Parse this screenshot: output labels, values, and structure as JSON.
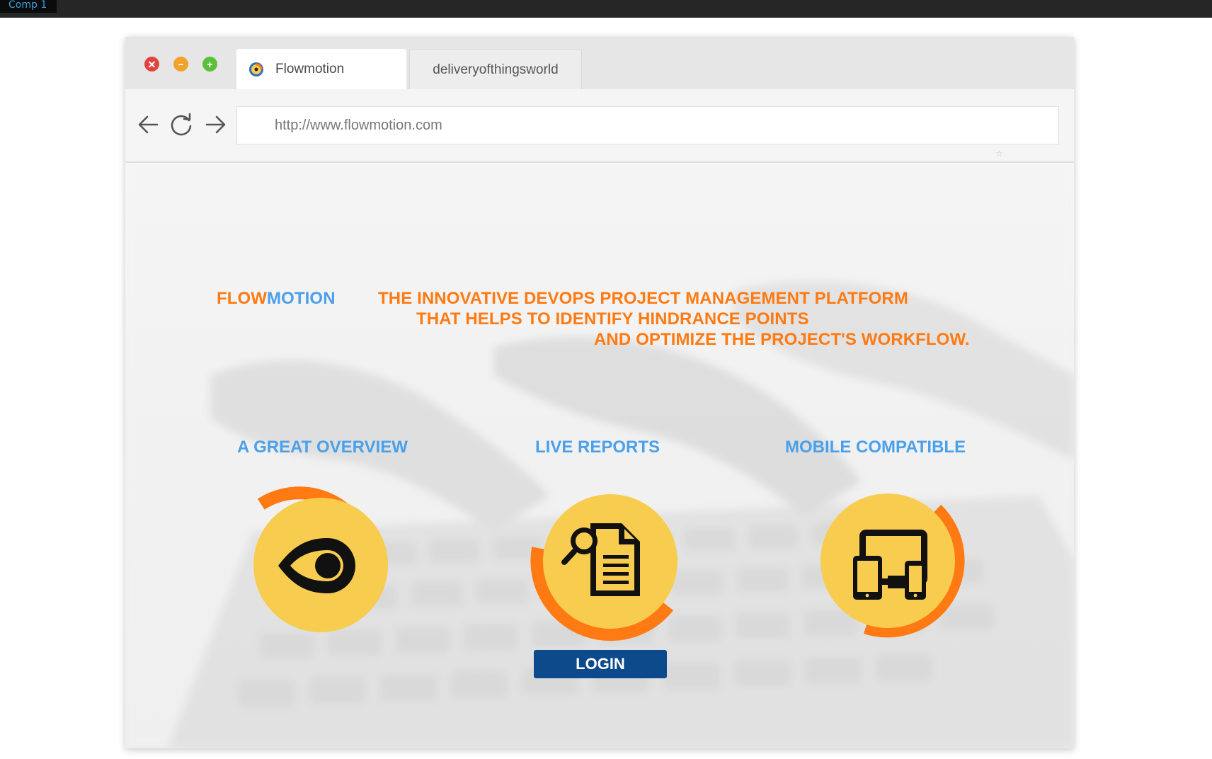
{
  "comp_tab": "Comp 1",
  "window_controls": {
    "close_symbol": "✕",
    "minimize_symbol": "−",
    "maximize_symbol": "+"
  },
  "tabs": [
    {
      "label": "Flowmotion",
      "icon": "flowmotion-favicon",
      "active": true
    },
    {
      "label": "deliveryofthingsworld",
      "active": false
    }
  ],
  "nav": {
    "back_icon": "arrow-left-icon",
    "reload_icon": "reload-icon",
    "forward_icon": "arrow-right-icon"
  },
  "address_bar": {
    "url": "http://www.flowmotion.com"
  },
  "hero": {
    "brand_part1": "FLOW",
    "brand_part2": "MOTION",
    "line1": "THE INNOVATIVE DEVOPS PROJECT MANAGEMENT PLATFORM",
    "line2": "THAT HELPS TO IDENTIFY HINDRANCE POINTS",
    "line3": "AND OPTIMIZE THE PROJECT'S WORKFLOW."
  },
  "features": [
    {
      "title": "A GREAT OVERVIEW",
      "icon": "eye-icon"
    },
    {
      "title": "LIVE REPORTS",
      "icon": "report-search-icon"
    },
    {
      "title": "MOBILE COMPATIBLE",
      "icon": "devices-icon"
    }
  ],
  "login_label": "LOGIN",
  "colors": {
    "brand_orange": "#ff7a12",
    "brand_blue": "#4aa0ea",
    "circle_yellow": "#f8cc4e",
    "button_navy": "#0d4a8b"
  }
}
